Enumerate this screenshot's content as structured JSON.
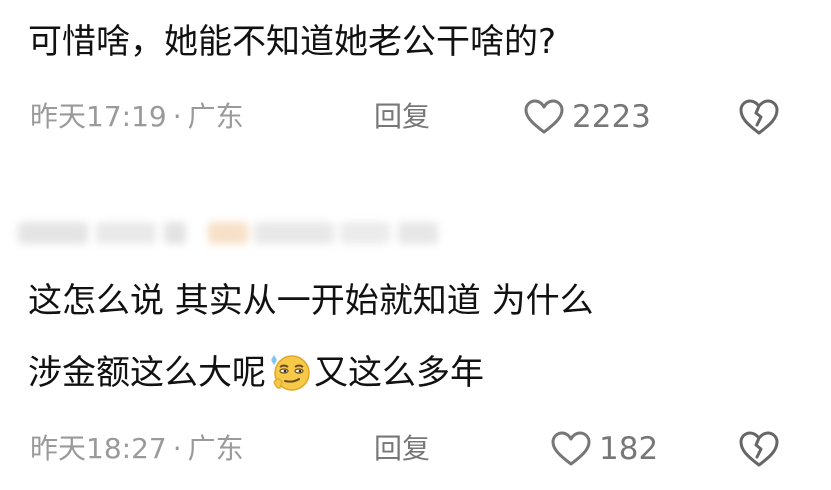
{
  "comments": [
    {
      "text_lines": [
        "可惜啥，她能不知道她老公干啥的?"
      ],
      "time": "昨天17:19",
      "separator": "·",
      "location": "广东",
      "reply_label": "回复",
      "likes": "2223"
    },
    {
      "text_lines": [
        "这怎么说 其实从一开始就知道 为什么",
        "涉金额这么大呢",
        "又这么多年"
      ],
      "time": "昨天18:27",
      "separator": "·",
      "location": "广东",
      "reply_label": "回复",
      "likes": "182"
    }
  ],
  "colors": {
    "text": "#111111",
    "meta": "#9a9a9a",
    "action": "#777777"
  },
  "icons": {
    "like": "heart-outline-icon",
    "dislike": "broken-heart-icon",
    "emoji": "smirk-emoji-icon"
  }
}
